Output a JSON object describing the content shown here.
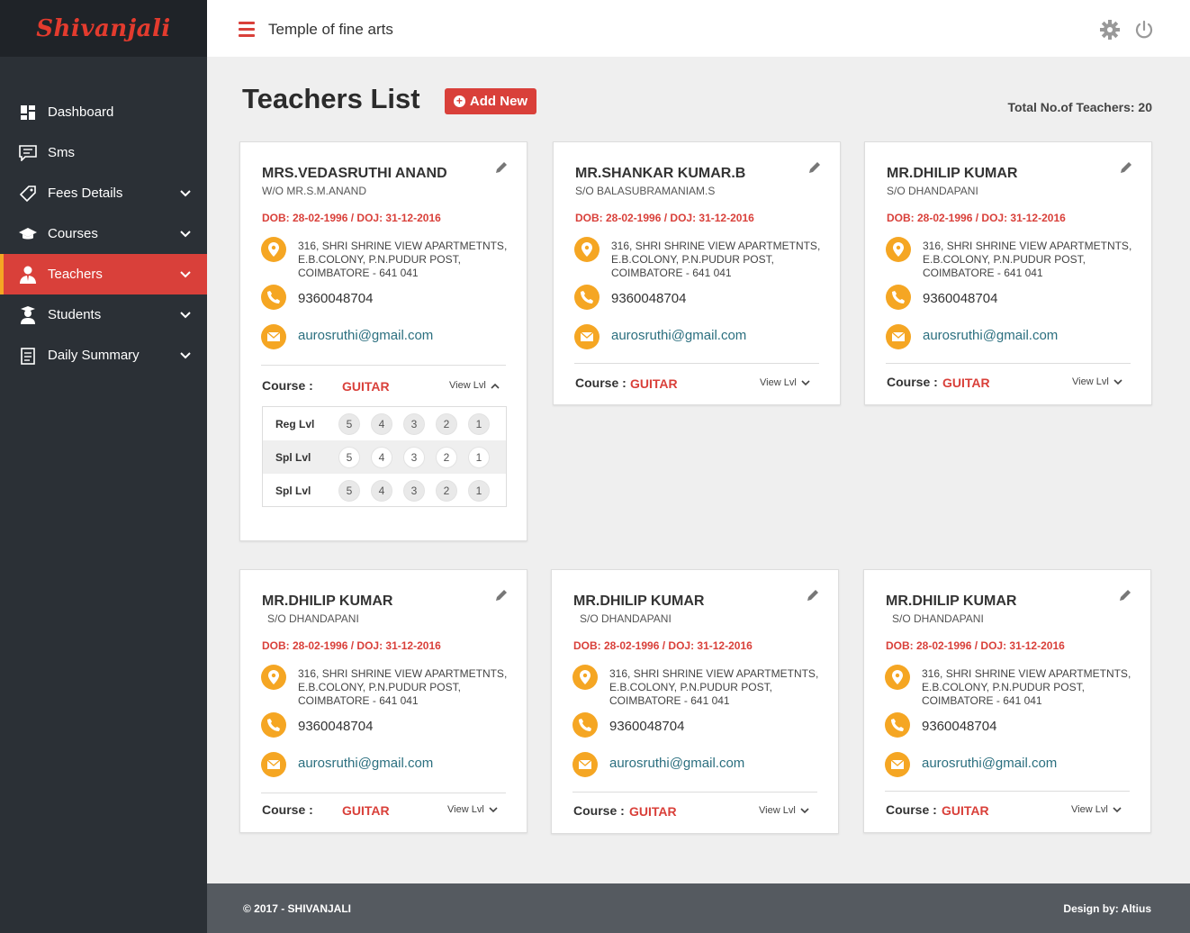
{
  "app": {
    "logo_text": "Shivanjali",
    "header_title": "Temple of fine arts"
  },
  "sidebar": {
    "items": [
      {
        "label": "Dashboard",
        "icon": "dashboard-icon",
        "chevron": false,
        "active": false
      },
      {
        "label": "Sms",
        "icon": "message-icon",
        "chevron": false,
        "active": false
      },
      {
        "label": "Fees Details",
        "icon": "tag-icon",
        "chevron": true,
        "active": false
      },
      {
        "label": "Courses",
        "icon": "graduation-cap-icon",
        "chevron": true,
        "active": false
      },
      {
        "label": "Teachers",
        "icon": "teacher-icon",
        "chevron": true,
        "active": true
      },
      {
        "label": "Students",
        "icon": "student-icon",
        "chevron": true,
        "active": false
      },
      {
        "label": "Daily Summary",
        "icon": "clipboard-icon",
        "chevron": true,
        "active": false
      }
    ]
  },
  "page": {
    "title": "Teachers List",
    "add_button": "Add New",
    "total": "Total No.of Teachers: 20"
  },
  "colors": {
    "accent_red": "#d9403a",
    "accent_orange": "#f5a623",
    "sidebar_bg": "#2b3036"
  },
  "course_label": "Course :",
  "view_level_label": "View Lvl",
  "teachers": [
    {
      "name": "MRS.VEDASRUTHI ANAND",
      "relation": "W/O MR.S.M.ANAND",
      "dob": "DOB: 28-02-1996",
      "doj": "/ DOJ: 31-12-2016",
      "address": [
        "316, SHRI SHRINE VIEW APARTMETNTS,",
        "E.B.COLONY, P.N.PUDUR POST,",
        "COIMBATORE - 641 041"
      ],
      "phone": "9360048704",
      "email": "aurosruthi@gmail.com",
      "course": "GUITAR",
      "expanded": true,
      "levels": [
        {
          "label": "Reg Lvl",
          "values": [
            "5",
            "4",
            "3",
            "2",
            "1"
          ]
        },
        {
          "label": "Spl Lvl",
          "values": [
            "5",
            "4",
            "3",
            "2",
            "1"
          ]
        },
        {
          "label": "Spl Lvl",
          "values": [
            "5",
            "4",
            "3",
            "2",
            "1"
          ]
        }
      ]
    },
    {
      "name": "MR.SHANKAR KUMAR.B",
      "relation": "S/O BALASUBRAMANIAM.S",
      "dob": "DOB: 28-02-1996",
      "doj": "/ DOJ: 31-12-2016",
      "address": [
        "316, SHRI SHRINE VIEW APARTMETNTS,",
        "E.B.COLONY, P.N.PUDUR POST,",
        "COIMBATORE - 641 041"
      ],
      "phone": "9360048704",
      "email": "aurosruthi@gmail.com",
      "course": "GUITAR",
      "expanded": false
    },
    {
      "name": "MR.DHILIP KUMAR",
      "relation": "S/O DHANDAPANI",
      "dob": "DOB: 28-02-1996",
      "doj": "/ DOJ: 31-12-2016",
      "address": [
        "316, SHRI SHRINE VIEW APARTMETNTS,",
        "E.B.COLONY, P.N.PUDUR POST,",
        "COIMBATORE - 641 041"
      ],
      "phone": "9360048704",
      "email": "aurosruthi@gmail.com",
      "course": "GUITAR",
      "expanded": false
    },
    {
      "name": "MR.DHILIP KUMAR",
      "relation": "S/O DHANDAPANI",
      "dob": "DOB: 28-02-1996",
      "doj": "/ DOJ: 31-12-2016",
      "address": [
        "316, SHRI SHRINE VIEW APARTMETNTS,",
        "E.B.COLONY, P.N.PUDUR POST,",
        "COIMBATORE - 641 041"
      ],
      "phone": "9360048704",
      "email": "aurosruthi@gmail.com",
      "course": "GUITAR",
      "expanded": false
    },
    {
      "name": "MR.DHILIP KUMAR",
      "relation": "S/O DHANDAPANI",
      "dob": "DOB: 28-02-1996",
      "doj": "/ DOJ: 31-12-2016",
      "address": [
        "316, SHRI SHRINE VIEW APARTMETNTS,",
        "E.B.COLONY, P.N.PUDUR POST,",
        "COIMBATORE - 641 041"
      ],
      "phone": "9360048704",
      "email": "aurosruthi@gmail.com",
      "course": "GUITAR",
      "expanded": false
    },
    {
      "name": "MR.DHILIP KUMAR",
      "relation": "S/O DHANDAPANI",
      "dob": "DOB: 28-02-1996",
      "doj": "/ DOJ: 31-12-2016",
      "address": [
        "316, SHRI SHRINE VIEW APARTMETNTS,",
        "E.B.COLONY, P.N.PUDUR POST,",
        "COIMBATORE - 641 041"
      ],
      "phone": "9360048704",
      "email": "aurosruthi@gmail.com",
      "course": "GUITAR",
      "expanded": false
    }
  ],
  "footer": {
    "copyright": "© 2017 - SHIVANJALI",
    "design": "Design by: Altius"
  }
}
